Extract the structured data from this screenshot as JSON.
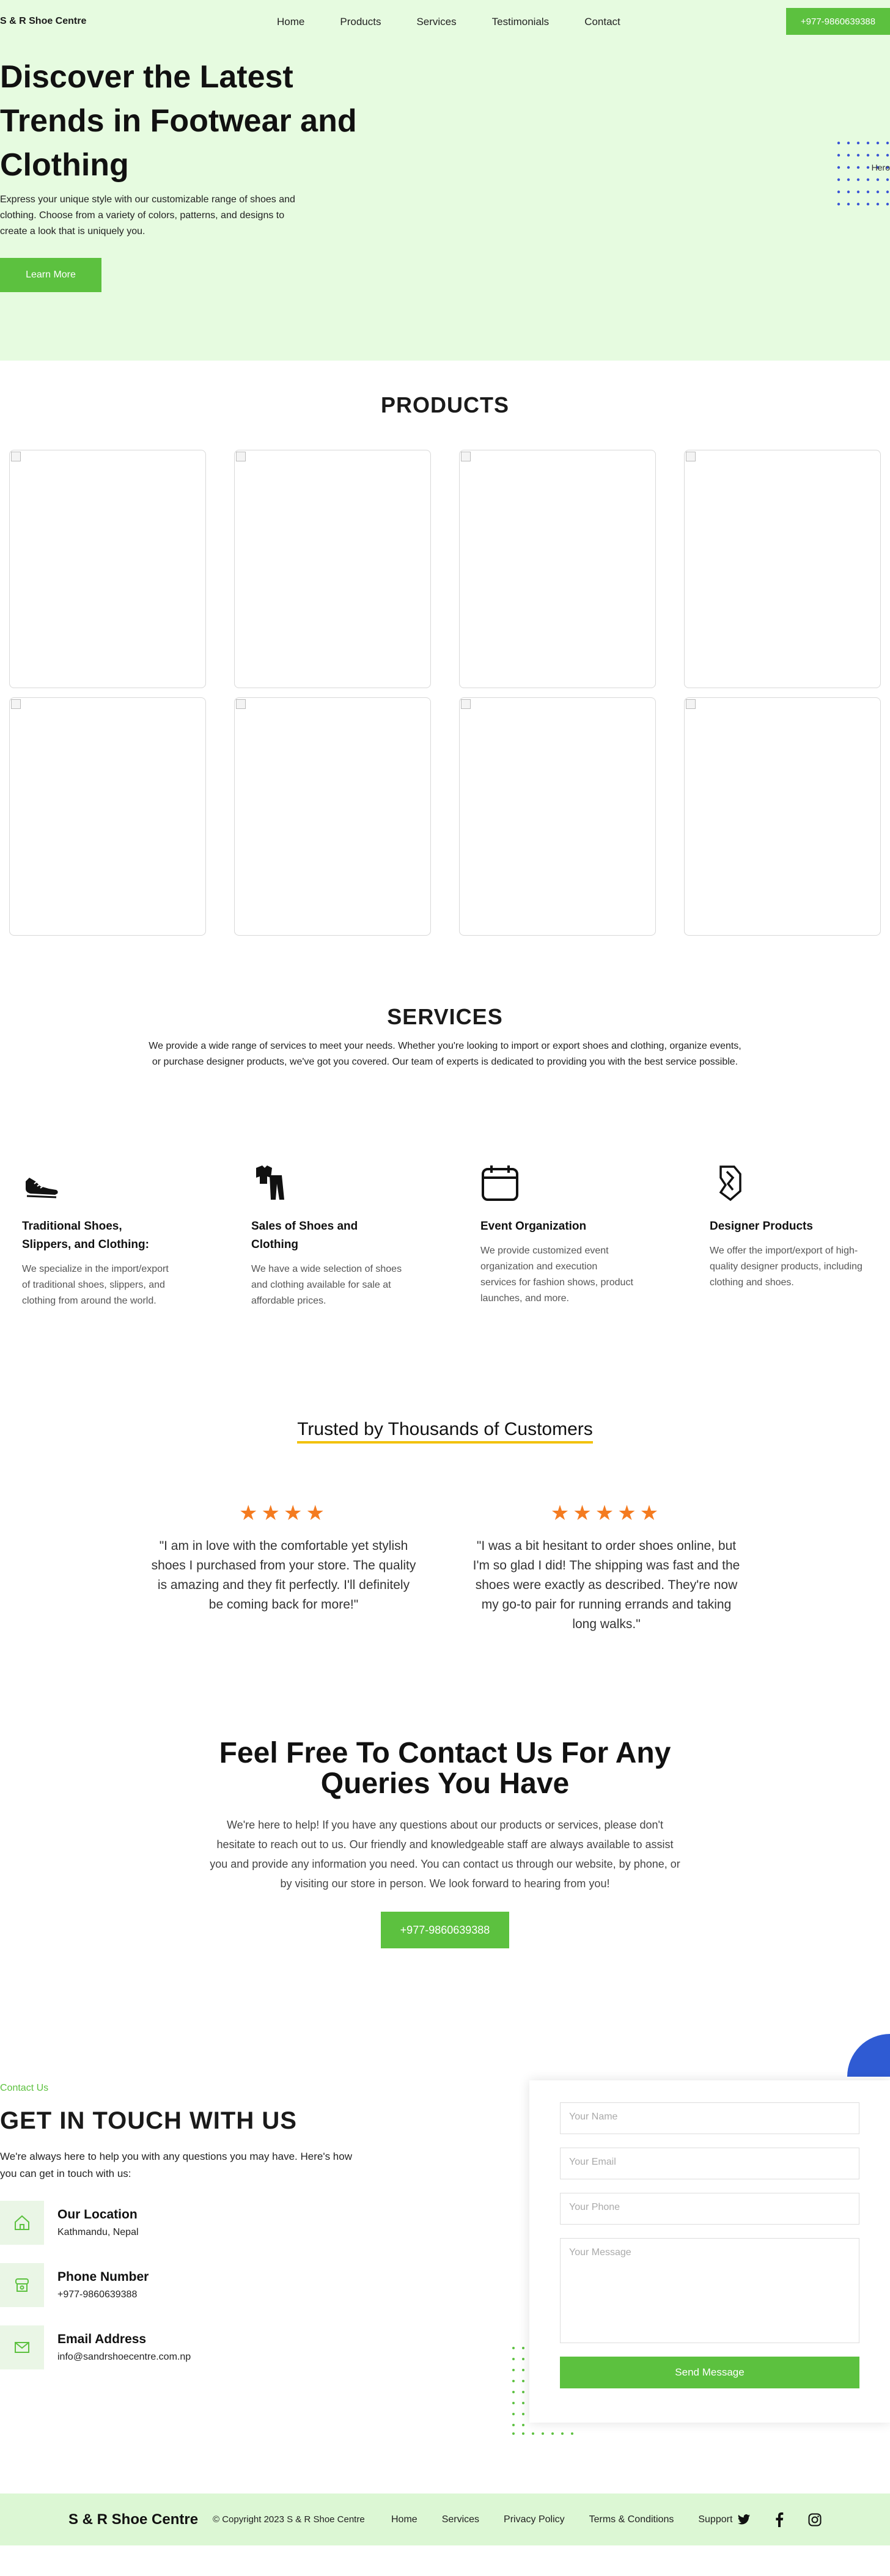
{
  "nav": {
    "brand": "S & R Shoe Centre",
    "links": [
      "Home",
      "Products",
      "Services",
      "Testimonials",
      "Contact"
    ],
    "phone": "+977-9860639388"
  },
  "hero": {
    "title": "Discover the Latest Trends in Footwear and Clothing",
    "text": "Express your unique style with our customizable range of shoes and clothing. Choose from a variety of colors, patterns, and designs to create a look that is uniquely you.",
    "button": "Learn More",
    "image_alt": "Hero"
  },
  "products": {
    "title": "PRODUCTS",
    "count": 8
  },
  "services": {
    "title": "SERVICES",
    "lead": "We provide a wide range of services to meet your needs. Whether you're looking to import or export shoes and clothing, organize events, or purchase designer products, we've got you covered. Our team of experts is dedicated to providing you with the best service possible.",
    "items": [
      {
        "icon": "shoe-icon",
        "title": "Traditional Shoes, Slippers, and Clothing:",
        "text": "We specialize in the import/export of traditional shoes, slippers, and clothing from around the world."
      },
      {
        "icon": "clothing-icon",
        "title": "Sales of Shoes and Clothing",
        "text": "We have a wide selection of shoes and clothing available for sale at affordable prices."
      },
      {
        "icon": "calendar-icon",
        "title": "Event Organization",
        "text": "We provide customized event organization and execution services for fashion shows, product launches, and more."
      },
      {
        "icon": "designer-icon",
        "title": "Designer Products",
        "text": "We offer the import/export of high-quality designer products, including clothing and shoes."
      }
    ]
  },
  "testimonials": {
    "title": "Trusted by Thousands of Customers",
    "items": [
      {
        "stars": "★★★★",
        "rating": 4,
        "text": "\"I am in love with the comfortable yet stylish shoes I purchased from your store. The quality is amazing and they fit perfectly. I'll definitely be coming back for more!\""
      },
      {
        "stars": "★★★★★",
        "rating": 5,
        "text": "\"I was a bit hesitant to order shoes online, but I'm so glad I did! The shipping was fast and the shoes were exactly as described. They're now my go-to pair for running errands and taking long walks.\""
      }
    ]
  },
  "cta": {
    "title": "Feel Free To Contact Us For Any Queries You Have",
    "text": "We're here to help! If you have any questions about our products or services, please don't hesitate to reach out to us. Our friendly and knowledgeable staff are always available to assist you and provide any information you need. You can contact us through our website, by phone, or by visiting our store in person. We look forward to hearing from you!",
    "button": "+977-9860639388"
  },
  "contact": {
    "kicker": "Contact Us",
    "title": "GET IN TOUCH WITH US",
    "intro": "We're always here to help you with any questions you may have. Here's how you can get in touch with us:",
    "location_title": "Our Location",
    "location_value": "Kathmandu, Nepal",
    "phone_title": "Phone Number",
    "phone_value": "+977-9860639388",
    "email_title": "Email Address",
    "email_value": "info@sandrshoecentre.com.np",
    "form": {
      "name_placeholder": "Your Name",
      "email_placeholder": "Your Email",
      "phone_placeholder": "Your Phone",
      "message_placeholder": "Your Message",
      "submit": "Send Message"
    }
  },
  "footer": {
    "brand": "S & R Shoe Centre",
    "copyright": "© Copyright 2023 S & R Shoe Centre",
    "links": [
      "Home",
      "Services",
      "Privacy Policy",
      "Terms & Conditions",
      "Support"
    ],
    "social": [
      "twitter-icon",
      "facebook-icon",
      "instagram-icon"
    ]
  },
  "colors": {
    "accent": "#5cc13f",
    "hero_bg": "#e6fbe0",
    "star": "#f47b20",
    "underline": "#f2c20c",
    "blue_shape": "#2f5bd3"
  }
}
